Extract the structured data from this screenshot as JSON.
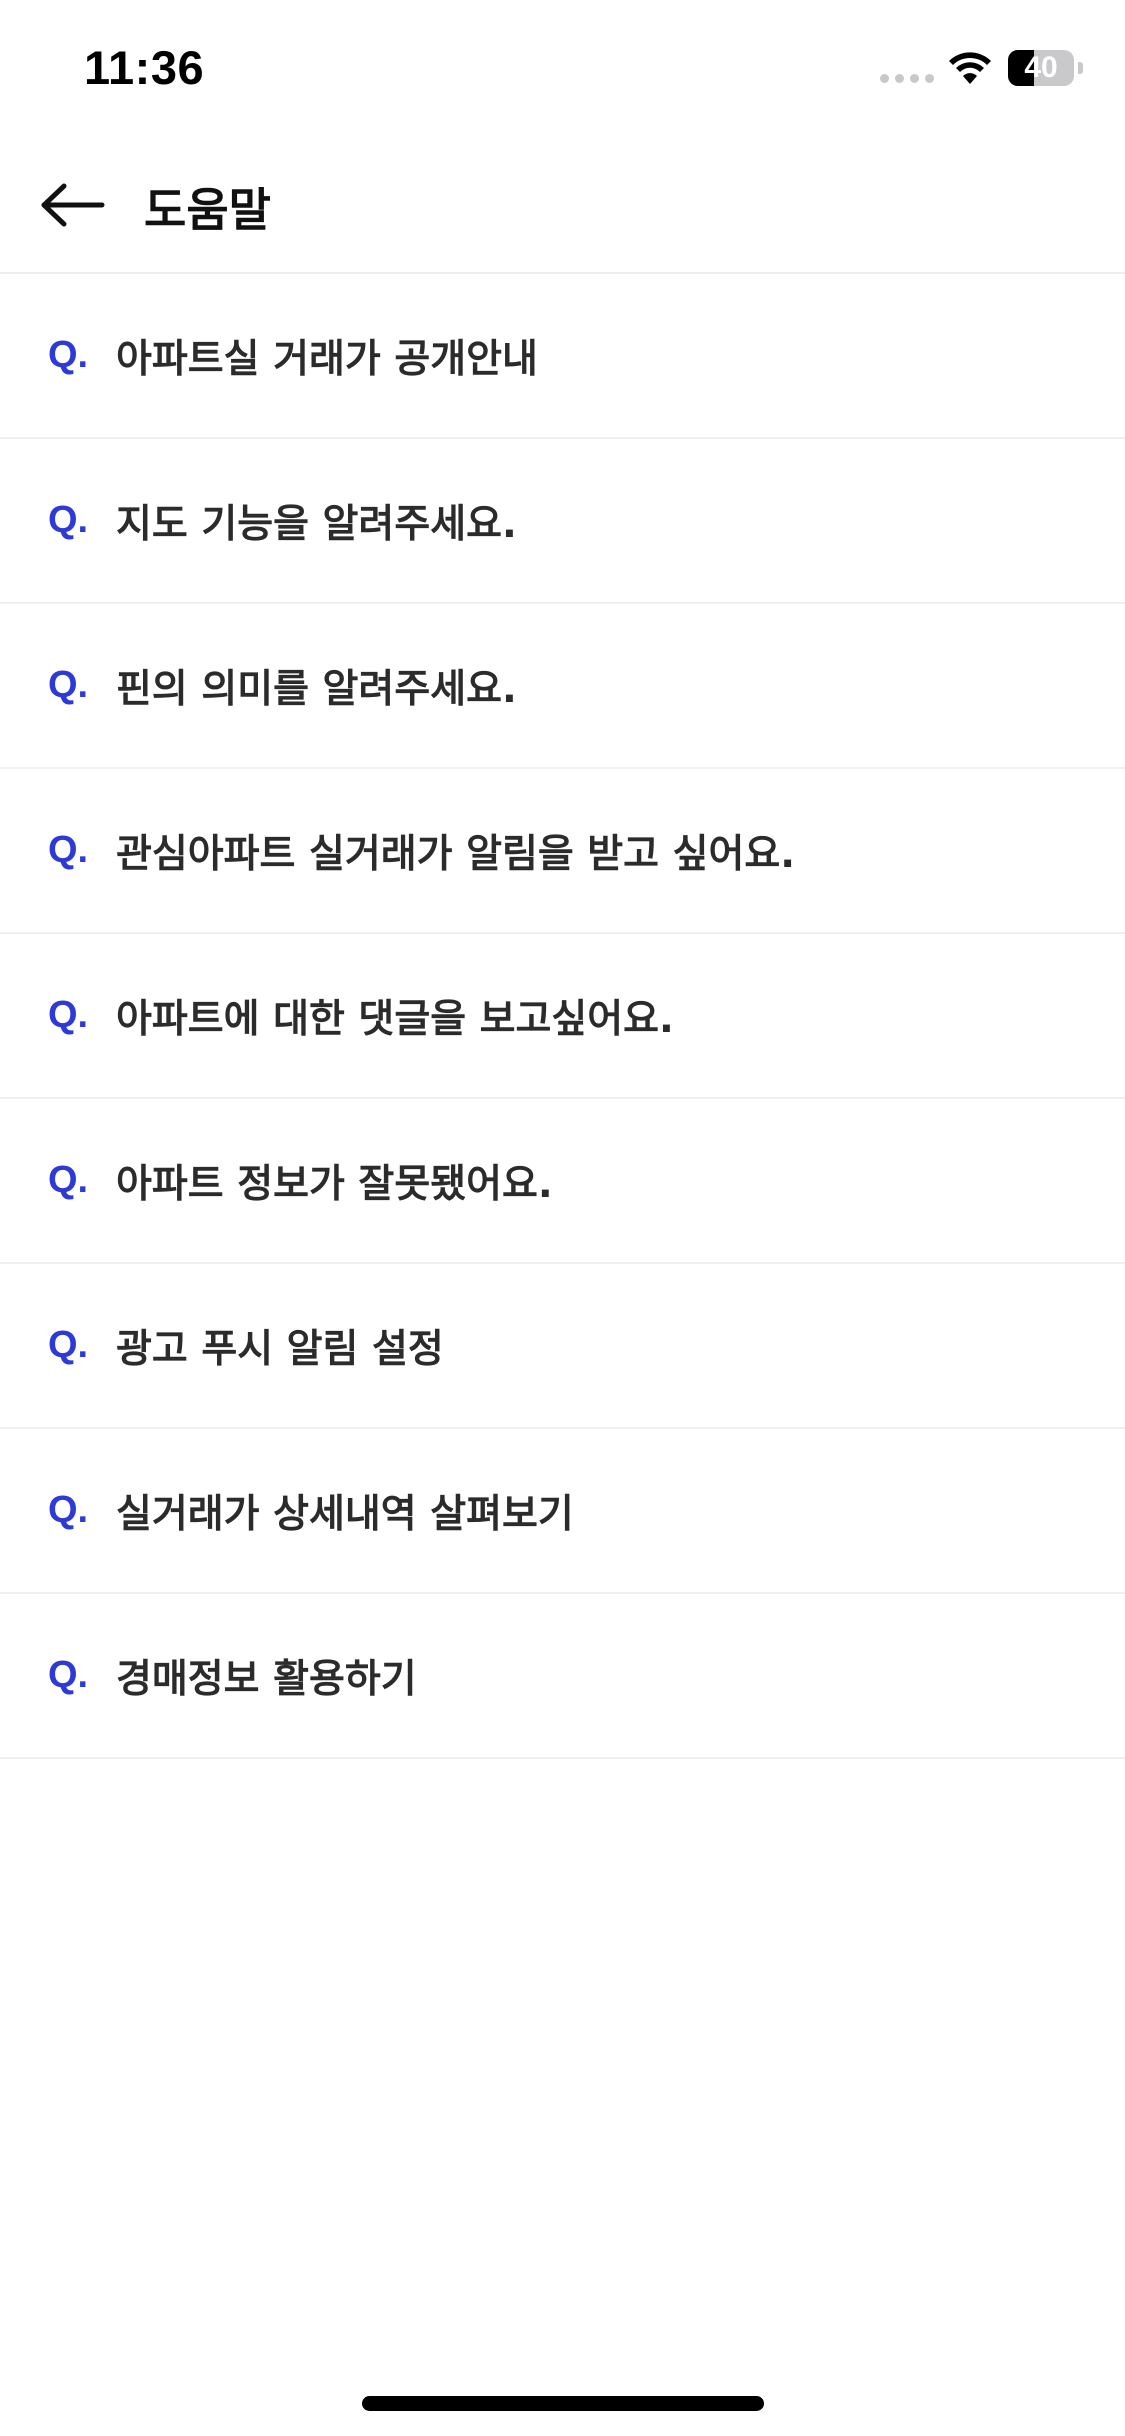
{
  "status_bar": {
    "time": "11:36",
    "battery_level": "40",
    "battery_fraction": 0.4,
    "icons": [
      "signal-dots-icon",
      "wifi-icon",
      "battery-icon"
    ]
  },
  "header": {
    "back_icon": "arrow-left-icon",
    "title": "도움말"
  },
  "faq": {
    "prefix": "Q.",
    "items": [
      "아파트실 거래가 공개안내",
      "지도 기능을 알려주세요.",
      "핀의 의미를 알려주세요.",
      "관심아파트 실거래가 알림을 받고 싶어요.",
      "아파트에 대한 댓글을 보고싶어요.",
      "아파트 정보가 잘못됐어요.",
      "광고 푸시 알림 설정",
      "실거래가 상세내역 살펴보기",
      "경매정보 활용하기"
    ]
  },
  "colors": {
    "accent": "#2d3ad6",
    "text": "#2b2b2b",
    "divider": "#f0f0f0",
    "background": "#ffffff"
  }
}
